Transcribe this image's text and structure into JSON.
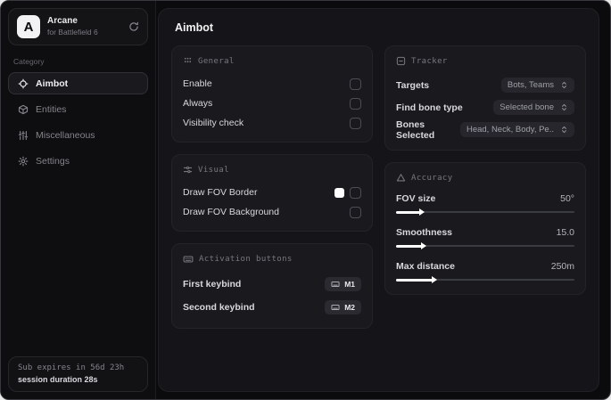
{
  "app": {
    "name": "Arcane",
    "subtitle": "for Battlefield 6",
    "logo_letter": "A"
  },
  "sidebar": {
    "category_label": "Category",
    "items": [
      {
        "label": "Aimbot",
        "icon": "crosshair-icon",
        "active": true
      },
      {
        "label": "Entities",
        "icon": "cube-icon",
        "active": false
      },
      {
        "label": "Miscellaneous",
        "icon": "sliders-icon",
        "active": false
      },
      {
        "label": "Settings",
        "icon": "gear-icon",
        "active": false
      }
    ],
    "sub_line1": "Sub expires in 56d 23h",
    "sub_line2": "session duration 28s"
  },
  "main": {
    "title": "Aimbot"
  },
  "general": {
    "title": "General",
    "rows": [
      {
        "label": "Enable",
        "control": "checkbox",
        "checked": false
      },
      {
        "label": "Always",
        "control": "checkbox",
        "checked": false
      },
      {
        "label": "Visibility check",
        "control": "checkbox",
        "checked": false
      }
    ]
  },
  "visual": {
    "title": "Visual",
    "rows": [
      {
        "label": "Draw FOV Border",
        "control": "color+checkbox",
        "color": "#ffffff",
        "checked": false
      },
      {
        "label": "Draw FOV Background",
        "control": "checkbox",
        "checked": false
      }
    ]
  },
  "activation": {
    "title": "Activation buttons",
    "rows": [
      {
        "label": "First keybind",
        "key": "M1"
      },
      {
        "label": "Second keybind",
        "key": "M2"
      }
    ]
  },
  "tracker": {
    "title": "Tracker",
    "rows": [
      {
        "label": "Targets",
        "value": "Bots, Teams"
      },
      {
        "label": "Find bone type",
        "value": "Selected bone"
      },
      {
        "label": "Bones Selected",
        "value": "Head, Neck, Body, Pe.."
      }
    ]
  },
  "accuracy": {
    "title": "Accuracy",
    "sliders": [
      {
        "label": "FOV size",
        "value": "50°",
        "fill_pct": 14
      },
      {
        "label": "Smoothness",
        "value": "15.0",
        "fill_pct": 15
      },
      {
        "label": "Max distance",
        "value": "250m",
        "fill_pct": 21
      }
    ]
  },
  "colors": {
    "swatch_white": "#ffffff"
  }
}
